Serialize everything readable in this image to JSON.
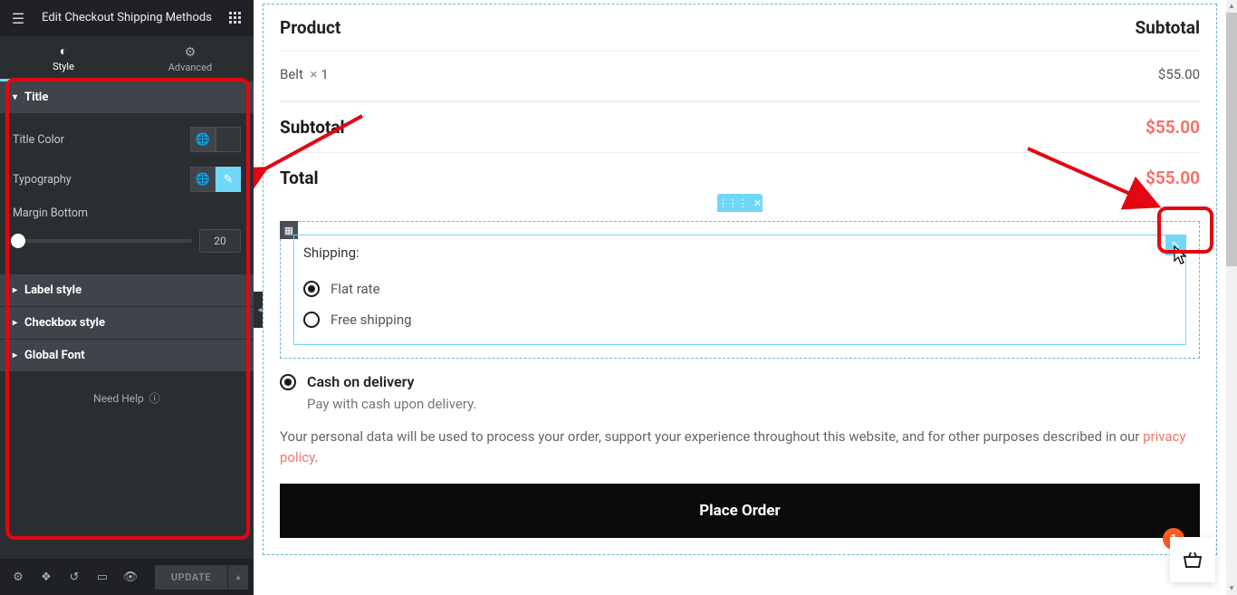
{
  "sidebar": {
    "title": "Edit Checkout Shipping Methods",
    "tabs": {
      "style": "Style",
      "advanced": "Advanced"
    },
    "sections": {
      "title": {
        "header": "Title",
        "title_color_label": "Title Color",
        "typography_label": "Typography",
        "margin_bottom_label": "Margin Bottom",
        "margin_bottom_value": "20"
      },
      "label_style": "Label style",
      "checkbox_style": "Checkbox style",
      "global_font": "Global Font"
    },
    "help": "Need Help",
    "footer": {
      "update": "UPDATE"
    }
  },
  "preview": {
    "headers": {
      "product": "Product",
      "subtotal": "Subtotal"
    },
    "item": {
      "name": "Belt",
      "qty_prefix": "×",
      "qty": "1",
      "price": "$55.00"
    },
    "subtotal_label": "Subtotal",
    "subtotal_value": "$55.00",
    "total_label": "Total",
    "total_value": "$55.00",
    "shipping": {
      "title": "Shipping:",
      "option_flat": "Flat rate",
      "option_free": "Free shipping"
    },
    "payment": {
      "cod_label": "Cash on delivery",
      "cod_desc": "Pay with cash upon delivery."
    },
    "privacy_text": "Your personal data will be used to process your order, support your experience throughout this website, and for other purposes described in our ",
    "privacy_link": "privacy policy",
    "privacy_end": ".",
    "place_order": "Place Order",
    "cart_count": "1"
  }
}
